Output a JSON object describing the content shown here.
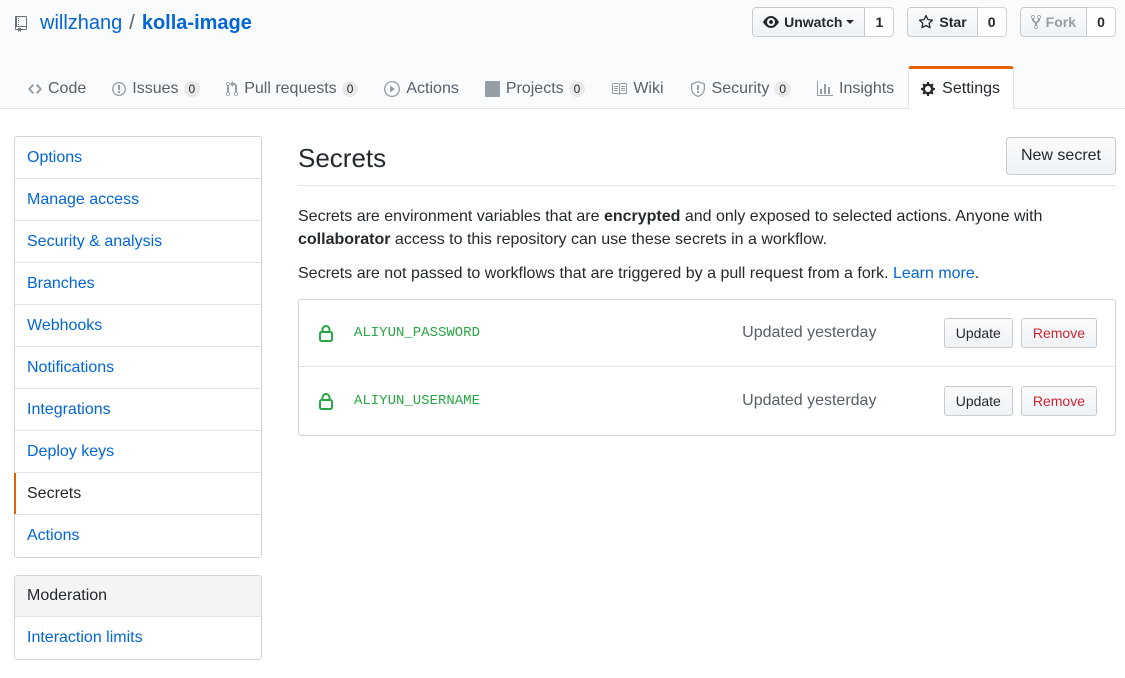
{
  "repo": {
    "owner": "willzhang",
    "separator": "/",
    "name": "kolla-image"
  },
  "actions": {
    "watch": {
      "label": "Unwatch",
      "count": "1",
      "icon": "eye-icon"
    },
    "star": {
      "label": "Star",
      "count": "0",
      "icon": "star-icon"
    },
    "fork": {
      "label": "Fork",
      "count": "0",
      "icon": "fork-icon"
    }
  },
  "nav": [
    {
      "label": "Code",
      "icon": "code-icon"
    },
    {
      "label": "Issues",
      "count": "0",
      "icon": "issue-icon"
    },
    {
      "label": "Pull requests",
      "count": "0",
      "icon": "pull-request-icon"
    },
    {
      "label": "Actions",
      "icon": "play-icon"
    },
    {
      "label": "Projects",
      "count": "0",
      "icon": "project-icon"
    },
    {
      "label": "Wiki",
      "icon": "book-icon"
    },
    {
      "label": "Security",
      "count": "0",
      "icon": "shield-icon"
    },
    {
      "label": "Insights",
      "icon": "graph-icon"
    },
    {
      "label": "Settings",
      "icon": "gear-icon",
      "selected": true
    }
  ],
  "sidebar": {
    "items": [
      {
        "label": "Options"
      },
      {
        "label": "Manage access"
      },
      {
        "label": "Security & analysis"
      },
      {
        "label": "Branches"
      },
      {
        "label": "Webhooks"
      },
      {
        "label": "Notifications"
      },
      {
        "label": "Integrations"
      },
      {
        "label": "Deploy keys"
      },
      {
        "label": "Secrets",
        "selected": true
      },
      {
        "label": "Actions"
      }
    ],
    "moderation": {
      "heading": "Moderation",
      "items": [
        {
          "label": "Interaction limits"
        }
      ]
    }
  },
  "main": {
    "title": "Secrets",
    "new_button": "New secret",
    "desc": {
      "p1_a": "Secrets are environment variables that are ",
      "p1_b": "encrypted",
      "p1_c": " and only exposed to selected actions. Anyone with ",
      "p1_d": "collaborator",
      "p1_e": " access to this repository can use these secrets in a workflow.",
      "p2_a": "Secrets are not passed to workflows that are triggered by a pull request from a fork. ",
      "p2_link": "Learn more",
      "p2_end": "."
    },
    "secrets": [
      {
        "name": "ALIYUN_PASSWORD",
        "updated": "Updated yesterday",
        "update_label": "Update",
        "remove_label": "Remove"
      },
      {
        "name": "ALIYUN_USERNAME",
        "updated": "Updated yesterday",
        "update_label": "Update",
        "remove_label": "Remove"
      }
    ]
  },
  "colors": {
    "link": "#0366d6",
    "accent": "#e36209",
    "secret": "#28a745",
    "danger": "#cb2431"
  }
}
